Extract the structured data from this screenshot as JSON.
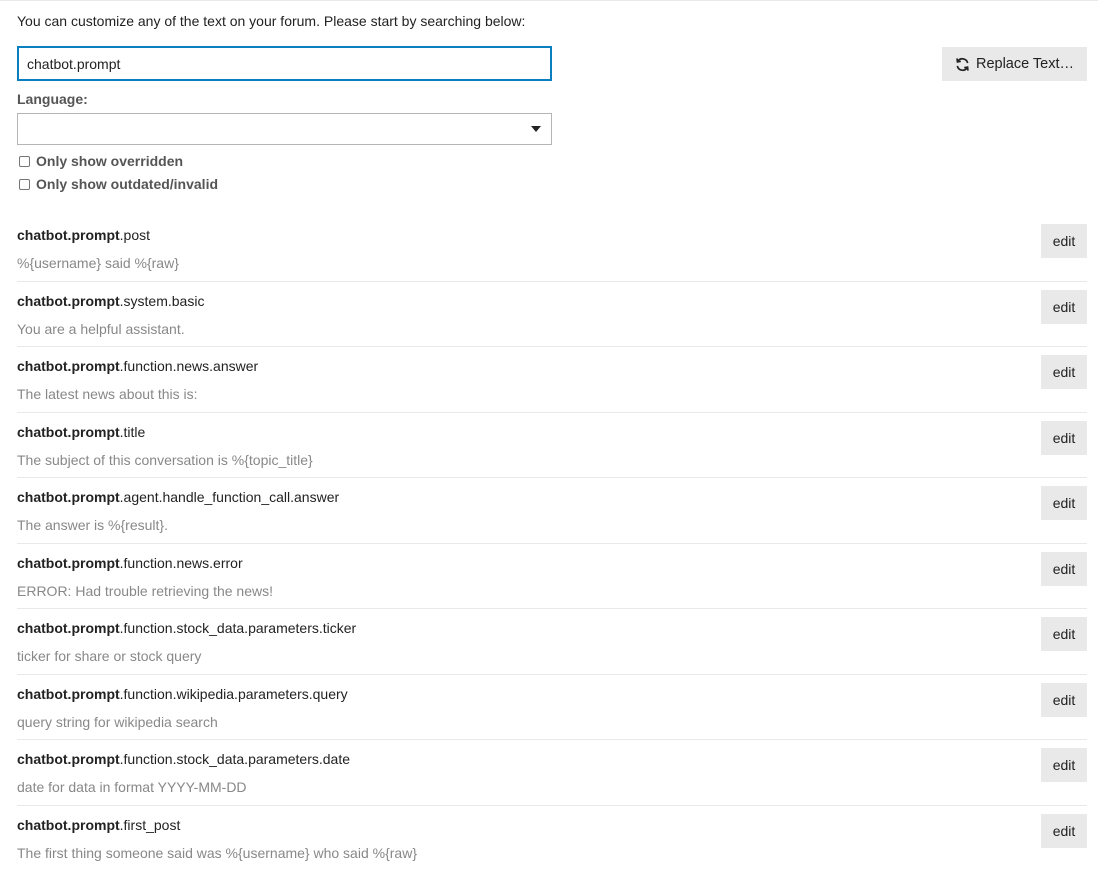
{
  "intro": "You can customize any of the text on your forum. Please start by searching below:",
  "search": {
    "value": "chatbot.prompt"
  },
  "replace_button": {
    "label": "Replace Text…",
    "icon": "refresh-icon"
  },
  "language": {
    "label": "Language:",
    "selected": ""
  },
  "filters": [
    {
      "label": "Only show overridden",
      "checked": false
    },
    {
      "label": "Only show outdated/invalid",
      "checked": false
    }
  ],
  "edit_label": "edit",
  "results": [
    {
      "prefix": "chatbot.prompt",
      "suffix": ".post",
      "value": "%{username} said %{raw}",
      "edit": "edit"
    },
    {
      "prefix": "chatbot.prompt",
      "suffix": ".system.basic",
      "value": "You are a helpful assistant.",
      "edit": "edit"
    },
    {
      "prefix": "chatbot.prompt",
      "suffix": ".function.news.answer",
      "value": "The latest news about this is:",
      "edit": "edit"
    },
    {
      "prefix": "chatbot.prompt",
      "suffix": ".title",
      "value": "The subject of this conversation is %{topic_title}",
      "edit": "edit"
    },
    {
      "prefix": "chatbot.prompt",
      "suffix": ".agent.handle_function_call.answer",
      "value": "The answer is %{result}.",
      "edit": "edit"
    },
    {
      "prefix": "chatbot.prompt",
      "suffix": ".function.news.error",
      "value": "ERROR: Had trouble retrieving the news!",
      "edit": "edit"
    },
    {
      "prefix": "chatbot.prompt",
      "suffix": ".function.stock_data.parameters.ticker",
      "value": "ticker for share or stock query",
      "edit": "edit"
    },
    {
      "prefix": "chatbot.prompt",
      "suffix": ".function.wikipedia.parameters.query",
      "value": "query string for wikipedia search",
      "edit": "edit"
    },
    {
      "prefix": "chatbot.prompt",
      "suffix": ".function.stock_data.parameters.date",
      "value": "date for data in format YYYY-MM-DD",
      "edit": "edit"
    },
    {
      "prefix": "chatbot.prompt",
      "suffix": ".first_post",
      "value": "The first thing someone said was %{username} who said %{raw}",
      "edit": "edit"
    }
  ],
  "colors": {
    "focus_border": "#0a7fbf",
    "button_bg": "#e9e9e9",
    "muted_text": "#888888"
  }
}
